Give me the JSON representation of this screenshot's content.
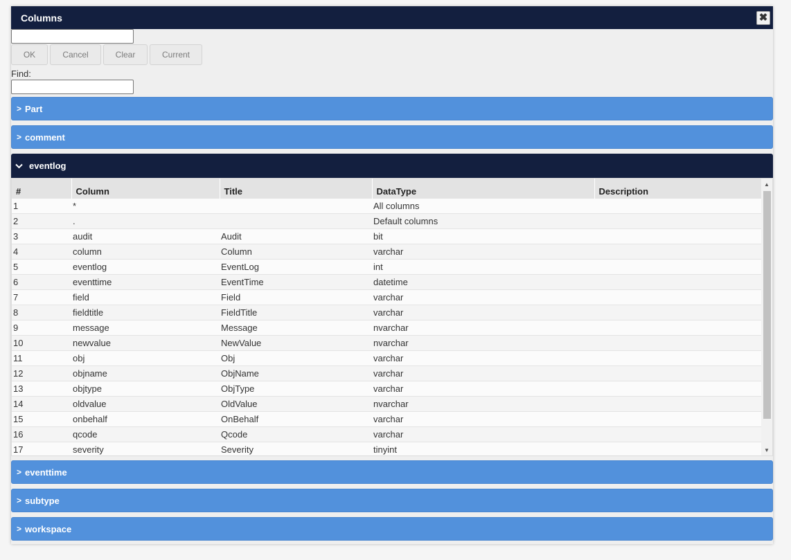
{
  "dialog": {
    "title": "Columns",
    "close_glyph": "✖"
  },
  "top_input": {
    "value": ""
  },
  "buttons": {
    "ok": "OK",
    "cancel": "Cancel",
    "clear": "Clear",
    "current": "Current"
  },
  "find": {
    "label": "Find:",
    "value": ""
  },
  "groups": [
    {
      "label": "Part",
      "expanded": false
    },
    {
      "label": "comment",
      "expanded": false
    },
    {
      "label": "eventlog",
      "expanded": true
    },
    {
      "label": "eventtime",
      "expanded": false
    },
    {
      "label": "subtype",
      "expanded": false
    },
    {
      "label": "workspace",
      "expanded": false
    }
  ],
  "icons": {
    "collapsed": "chevron-right-icon",
    "expanded": "chevron-down-icon"
  },
  "colors": {
    "titlebar": "#131f3f",
    "group": "#5291dc",
    "expanded_group": "#131f3f"
  },
  "table": {
    "headers": [
      "#",
      "Column",
      "Title",
      "DataType",
      "Description"
    ],
    "rows": [
      [
        "1",
        "*",
        "",
        "All columns",
        ""
      ],
      [
        "2",
        ".",
        "",
        "Default columns",
        ""
      ],
      [
        "3",
        "audit",
        "Audit",
        "bit",
        ""
      ],
      [
        "4",
        "column",
        "Column",
        "varchar",
        ""
      ],
      [
        "5",
        "eventlog",
        "EventLog",
        "int",
        ""
      ],
      [
        "6",
        "eventtime",
        "EventTime",
        "datetime",
        ""
      ],
      [
        "7",
        "field",
        "Field",
        "varchar",
        ""
      ],
      [
        "8",
        "fieldtitle",
        "FieldTitle",
        "varchar",
        ""
      ],
      [
        "9",
        "message",
        "Message",
        "nvarchar",
        ""
      ],
      [
        "10",
        "newvalue",
        "NewValue",
        "nvarchar",
        ""
      ],
      [
        "11",
        "obj",
        "Obj",
        "varchar",
        ""
      ],
      [
        "12",
        "objname",
        "ObjName",
        "varchar",
        ""
      ],
      [
        "13",
        "objtype",
        "ObjType",
        "varchar",
        ""
      ],
      [
        "14",
        "oldvalue",
        "OldValue",
        "nvarchar",
        ""
      ],
      [
        "15",
        "onbehalf",
        "OnBehalf",
        "varchar",
        ""
      ],
      [
        "16",
        "qcode",
        "Qcode",
        "varchar",
        ""
      ],
      [
        "17",
        "severity",
        "Severity",
        "tinyint",
        ""
      ]
    ]
  }
}
